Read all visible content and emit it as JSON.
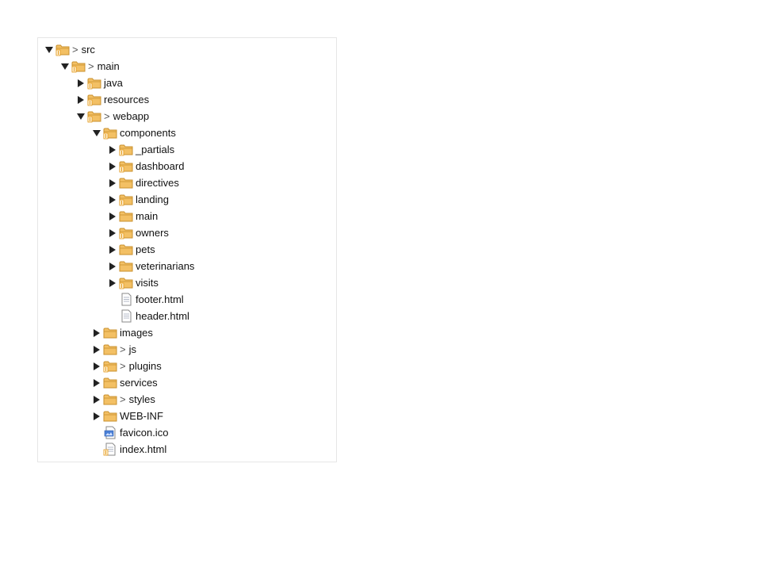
{
  "explorer": {
    "rows": [
      {
        "label": "src",
        "dirty": true,
        "kind": "folder",
        "state": "expanded",
        "depth": 0,
        "vcs": true
      },
      {
        "label": "main",
        "dirty": true,
        "kind": "folder",
        "state": "expanded",
        "depth": 1,
        "vcs": true
      },
      {
        "label": "java",
        "dirty": false,
        "kind": "folder",
        "state": "collapsed",
        "depth": 2,
        "vcs": true
      },
      {
        "label": "resources",
        "dirty": false,
        "kind": "folder",
        "state": "collapsed",
        "depth": 2,
        "vcs": true
      },
      {
        "label": "webapp",
        "dirty": true,
        "kind": "folder",
        "state": "expanded",
        "depth": 2,
        "vcs": true
      },
      {
        "label": "components",
        "dirty": false,
        "kind": "folder",
        "state": "expanded",
        "depth": 3,
        "vcs": true
      },
      {
        "label": "_partials",
        "dirty": false,
        "kind": "folder",
        "state": "collapsed",
        "depth": 4,
        "vcs": true
      },
      {
        "label": "dashboard",
        "dirty": false,
        "kind": "folder",
        "state": "collapsed",
        "depth": 4,
        "vcs": true
      },
      {
        "label": "directives",
        "dirty": false,
        "kind": "folder",
        "state": "collapsed",
        "depth": 4,
        "vcs": false
      },
      {
        "label": "landing",
        "dirty": false,
        "kind": "folder",
        "state": "collapsed",
        "depth": 4,
        "vcs": true
      },
      {
        "label": "main",
        "dirty": false,
        "kind": "folder",
        "state": "collapsed",
        "depth": 4,
        "vcs": false
      },
      {
        "label": "owners",
        "dirty": false,
        "kind": "folder",
        "state": "collapsed",
        "depth": 4,
        "vcs": true
      },
      {
        "label": "pets",
        "dirty": false,
        "kind": "folder",
        "state": "collapsed",
        "depth": 4,
        "vcs": false
      },
      {
        "label": "veterinarians",
        "dirty": false,
        "kind": "folder",
        "state": "collapsed",
        "depth": 4,
        "vcs": false
      },
      {
        "label": "visits",
        "dirty": false,
        "kind": "folder",
        "state": "collapsed",
        "depth": 4,
        "vcs": true
      },
      {
        "label": "footer.html",
        "dirty": false,
        "kind": "file",
        "state": "none",
        "depth": 4,
        "vcs": false
      },
      {
        "label": "header.html",
        "dirty": false,
        "kind": "file",
        "state": "none",
        "depth": 4,
        "vcs": false
      },
      {
        "label": "images",
        "dirty": false,
        "kind": "folder",
        "state": "collapsed",
        "depth": 3,
        "vcs": false
      },
      {
        "label": "js",
        "dirty": true,
        "kind": "folder",
        "state": "collapsed",
        "depth": 3,
        "vcs": false
      },
      {
        "label": "plugins",
        "dirty": true,
        "kind": "folder",
        "state": "collapsed",
        "depth": 3,
        "vcs": true
      },
      {
        "label": "services",
        "dirty": false,
        "kind": "folder",
        "state": "collapsed",
        "depth": 3,
        "vcs": false
      },
      {
        "label": "styles",
        "dirty": true,
        "kind": "folder",
        "state": "collapsed",
        "depth": 3,
        "vcs": false
      },
      {
        "label": "WEB-INF",
        "dirty": false,
        "kind": "folder",
        "state": "collapsed",
        "depth": 3,
        "vcs": false
      },
      {
        "label": "favicon.ico",
        "dirty": false,
        "kind": "image-file",
        "state": "none",
        "depth": 3,
        "vcs": false
      },
      {
        "label": "index.html",
        "dirty": false,
        "kind": "file",
        "state": "none",
        "depth": 3,
        "vcs": true
      }
    ],
    "dirty_marker": ">",
    "colors": {
      "folder_fill": "#f3c064",
      "folder_stroke": "#c9902e",
      "vcs_overlay": "#e59a1c",
      "file_fill": "#ffffff",
      "file_stroke": "#8a8a8a",
      "disclosure": "#222222"
    }
  }
}
